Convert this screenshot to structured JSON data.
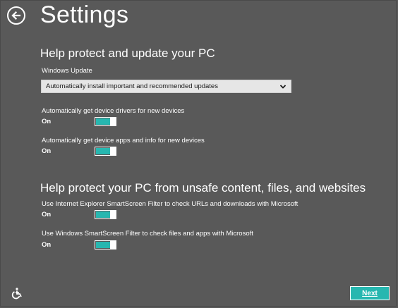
{
  "header": {
    "title": "Settings"
  },
  "section1": {
    "heading": "Help protect and update your PC",
    "windows_update": {
      "label": "Windows Update",
      "selected": "Automatically install important and recommended updates"
    },
    "toggles": [
      {
        "label": "Automatically get device drivers for new devices",
        "state": "On",
        "value": 1
      },
      {
        "label": "Automatically get device apps and info for new devices",
        "state": "On",
        "value": 1
      }
    ]
  },
  "section2": {
    "heading": "Help protect your PC from unsafe content, files, and websites",
    "toggles": [
      {
        "label": "Use Internet Explorer SmartScreen Filter to check URLs and downloads with Microsoft",
        "state": "On",
        "value": 1
      },
      {
        "label": "Use Windows SmartScreen Filter to check files and apps with Microsoft",
        "state": "On",
        "value": 1
      }
    ]
  },
  "footer": {
    "next_label": "Next"
  },
  "colors": {
    "background": "#595959",
    "accent": "#27b7b0",
    "text": "#ffffff"
  },
  "icons": {
    "back": "back-arrow-icon",
    "dropdown": "chevron-down-icon",
    "ease_of_access": "ease-of-access-icon"
  }
}
